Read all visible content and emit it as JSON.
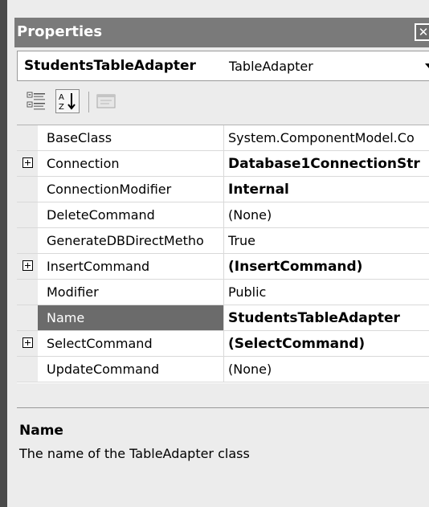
{
  "window": {
    "title": "Properties"
  },
  "object_selector": {
    "name": "StudentsTableAdapter",
    "type": "TableAdapter"
  },
  "toolbar": {
    "icons": [
      "categorized-icon",
      "alphabetical-icon",
      "property-pages-icon"
    ]
  },
  "grid": {
    "selected_row": "Name",
    "rows": [
      {
        "name": "BaseClass",
        "value": "System.ComponentModel.Co"
      },
      {
        "name": "Connection",
        "value": "Database1ConnectionStr",
        "expandable": true
      },
      {
        "name": "ConnectionModifier",
        "value": "Internal"
      },
      {
        "name": "DeleteCommand",
        "value": "(None)"
      },
      {
        "name": "GenerateDBDirectMetho",
        "value": "True"
      },
      {
        "name": "InsertCommand",
        "value": "(InsertCommand)",
        "expandable": true
      },
      {
        "name": "Modifier",
        "value": "Public"
      },
      {
        "name": "Name",
        "value": "StudentsTableAdapter"
      },
      {
        "name": "SelectCommand",
        "value": "(SelectCommand)",
        "expandable": true
      },
      {
        "name": "UpdateCommand",
        "value": "(None)"
      }
    ]
  },
  "description": {
    "title": "Name",
    "text": "The name of the TableAdapter class"
  },
  "colors": {
    "titlebar": "#7a7a7a",
    "selection": "#6b6b6b",
    "panel": "#ececec"
  }
}
